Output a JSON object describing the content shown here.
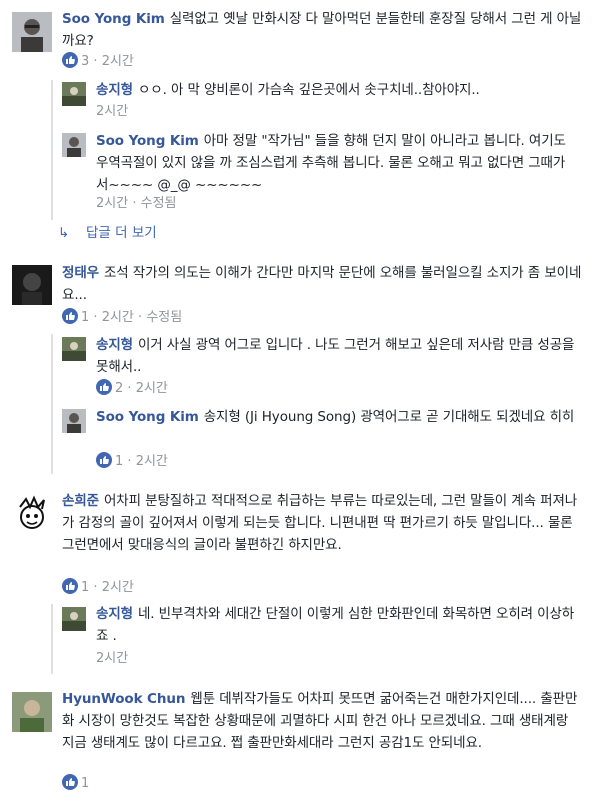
{
  "comments": [
    {
      "author": "Soo Yong Kim",
      "text": "실력없고 옛날 만화시장 다 말아먹던 분들한테 훈장질 당해서 그런 게 아닐까요?",
      "likes": "3",
      "time": "2시간",
      "replies": [
        {
          "author": "송지형",
          "text": "ㅇㅇ. 아 막 양비론이 가슴속 깊은곳에서 솟구치네..참아야지..",
          "time": "2시간"
        },
        {
          "author": "Soo Yong Kim",
          "text": "아마 정말 \"작가님\" 들을 향해 던지 말이 아니라고 봅니다. 여기도 우역곡절이 있지 않을 까 조심스럽게 추측해 봅니다. 물론 오해고 뭐고 없다면 그때가서~~~~ @_@ ~~~~~~",
          "time": "2시간",
          "edited": "수정됨"
        }
      ],
      "more_replies": "답글 더 보기"
    },
    {
      "author": "정태우",
      "text": "조석 작가의 의도는 이해가 간다만 마지막 문단에 오해를 불러일으킬 소지가 좀 보이네요...",
      "likes": "1",
      "time": "2시간",
      "edited": "수정됨",
      "replies": [
        {
          "author": "송지형",
          "text": "이거 사실 광역 어그로 입니다 . 나도 그런거 해보고 싶은데 저사람 만큼 성공을 못해서..",
          "likes": "2",
          "time": "2시간"
        },
        {
          "author": "Soo Yong Kim",
          "text": "송지형 (Ji Hyoung Song) 광역어그로 곧 기대해도 되겠네요 히히",
          "likes": "1",
          "time": "2시간"
        }
      ]
    },
    {
      "author": "손희준",
      "text": "어차피 분탕질하고 적대적으로 취급하는 부류는 따로있는데, 그런 말들이 계속 퍼져나가 감정의 골이 깊어져서 이렇게 되는듯 합니다. 니편내편 딱 편가르기 하듯 말입니다... 물론 그런면에서 맞대응식의 글이라 불편하긴 하지만요.",
      "likes": "1",
      "time": "2시간",
      "replies": [
        {
          "author": "송지형",
          "text": "네. 빈부격차와 세대간 단절이 이렇게 심한 만화판인데 화목하면 오히려 이상하죠 .",
          "time": "2시간"
        }
      ]
    },
    {
      "author": "HyunWook Chun",
      "text": "웹툰 데뷔작가들도 어차피 못뜨면 굶어죽는건 매한가지인데.... 출판만화 시장이 망한것도 복잡한 상황때문에 괴멸하다 시피 한건 아나 모르겠네요. 그때 생태계랑 지금 생태계도 많이 다르고요. 쩝 출판만화세대라 그런지 공감1도 안되네요.",
      "likes": "1",
      "time": ""
    }
  ],
  "separator": "·",
  "colors": {
    "link": "#365899",
    "meta": "#90949c",
    "like": "#4267b2"
  }
}
